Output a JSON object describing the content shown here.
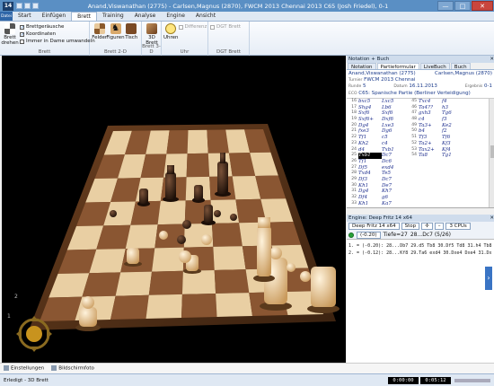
{
  "window": {
    "title": "Anand,Viswanathan (2775) - Carlsen,Magnus (2870), FWCM 2013 Chennai 2013  C65  (Josh Friedel), 0-1",
    "logo": "14",
    "controls": [
      "—",
      "□",
      "✕"
    ]
  },
  "tabs": [
    {
      "label": "Datei"
    },
    {
      "label": "Start"
    },
    {
      "label": "Einfügen"
    },
    {
      "label": "Brett"
    },
    {
      "label": "Training"
    },
    {
      "label": "Analyse"
    },
    {
      "label": "Engine"
    },
    {
      "label": "Ansicht"
    }
  ],
  "ribbon": {
    "brett_drehen": "Brett drehen",
    "checkboxes": [
      {
        "label": "Brettgeräusche",
        "checked": true
      },
      {
        "label": "Koordinaten",
        "checked": true
      },
      {
        "label": "Immer in Dame umwandeln",
        "checked": false
      }
    ],
    "group_brett": "Brett",
    "felder": "Felder",
    "figuren": "Figuren",
    "tisch": "Tisch",
    "group_brett2d": "Brett 2-D",
    "brett3d": "3D Brett",
    "group_brett3d": "Brett 3-D",
    "uhren": "Uhren",
    "differenz": "Differenz",
    "group_uhr": "Uhr",
    "dgt": "DGT Brett",
    "group_dgt": "DGT Brett",
    "colors": {
      "accent": "#2f66a8",
      "titlebar": "#5a8fc4"
    }
  },
  "notation": {
    "header": "Notation + Buch",
    "tabs": [
      "Notation",
      "Partieformular",
      "LiveBuch",
      "Buch"
    ],
    "white": "Anand,Viswanathan (2775)",
    "black": "Carlsen,Magnus (2870)",
    "turnier": "FWCM 2013 Chennai",
    "datum": "16.11.2013",
    "ergebnis": "0-1",
    "runde": "5",
    "eco": "C65: Spanische Partie (Berliner Verteidigung)",
    "labels": {
      "turnier": "Turnier",
      "datum": "Datum",
      "ergebnis": "Ergebnis",
      "runde": "Runde",
      "eco": "ECO"
    },
    "rows": [
      {
        "n": "16",
        "w": "bxc5",
        "b": "Lxc5",
        "n2": "45",
        "w2": "Txc4",
        "b2": "f4"
      },
      {
        "n": "17",
        "w": "Shg4",
        "b": "Lb6",
        "n2": "46",
        "w2": "Ta4??",
        "b2": "h3"
      },
      {
        "n": "18",
        "w": "Sxf6",
        "b": "Sxf6",
        "n2": "47",
        "w2": "gxh3",
        "b2": "Tg6"
      },
      {
        "n": "19",
        "w": "Sxf6+",
        "b": "Dxf6",
        "n2": "48",
        "w2": "c4",
        "b2": "f3"
      },
      {
        "n": "20",
        "w": "Dg4",
        "b": "Lxe3",
        "n2": "49",
        "w2": "Ta3+",
        "b2": "Ke2"
      },
      {
        "n": "21",
        "w": "fxe3",
        "b": "Dg6",
        "n2": "50",
        "w2": "b4",
        "b2": "f2"
      },
      {
        "n": "22",
        "w": "Tf1",
        "b": "c5",
        "n2": "51",
        "w2": "Tf3",
        "b2": "Tf6"
      },
      {
        "n": "23",
        "w": "Kh2",
        "b": "c4",
        "n2": "52",
        "w2": "Ta2+",
        "b2": "Kf3"
      },
      {
        "n": "24",
        "w": "d4",
        "b": "Txb1",
        "n2": "53",
        "w2": "Tax2+",
        "b2": "Kf4"
      },
      {
        "n": "25",
        "w": "Txb1",
        "b": "Dc7",
        "n2": "54",
        "w2": "Ta8",
        "b2": "Tg1"
      },
      {
        "n": "26",
        "w": "Tf1",
        "b": "Dc6",
        "n2": "",
        "w2": "",
        "b2": ""
      },
      {
        "n": "27",
        "w": "Df5",
        "b": "exd4",
        "n2": "",
        "w2": "",
        "b2": ""
      },
      {
        "n": "28",
        "w": "Txd4",
        "b": "Te5",
        "n2": "",
        "w2": "",
        "b2": ""
      },
      {
        "n": "29",
        "w": "Df3",
        "b": "Dc7",
        "n2": "",
        "w2": "",
        "b2": ""
      },
      {
        "n": "30",
        "w": "Kh1",
        "b": "De7",
        "n2": "",
        "w2": "",
        "b2": ""
      },
      {
        "n": "31",
        "w": "Dg4",
        "b": "Kh7",
        "n2": "",
        "w2": "",
        "b2": ""
      },
      {
        "n": "32",
        "w": "Df4",
        "b": "g6",
        "n2": "",
        "w2": "",
        "b2": ""
      },
      {
        "n": "33",
        "w": "Kh1",
        "b": "Ka7",
        "n2": "",
        "w2": "",
        "b2": ""
      }
    ]
  },
  "engine": {
    "header": "Engine: Deep Fritz 14 x64",
    "name": "Deep Fritz 14 x64",
    "stop": "Stop",
    "cpus": "3 CPUs",
    "eval": "(-0.20)",
    "depth": "Tiefe=27",
    "move": "28...Dc7 (5/26)",
    "lines": [
      "1. = (-0.20): 28...Db7 29.d5 Tb8 30.Df5 Td8 31.h4 Tb8 3",
      "2. = (-0.12): 28...Kf8 29.Ta6 exd4 30.Dxe4 Dxe4 31.Dx"
    ]
  },
  "bottom": {
    "einstellungen": "Einstellungen",
    "bildschirmfoto": "Bildschirmfoto"
  },
  "status": {
    "text": "Erledigt - 3D Brett",
    "clock1": "0:00:00",
    "clock2": "0:05:12"
  }
}
